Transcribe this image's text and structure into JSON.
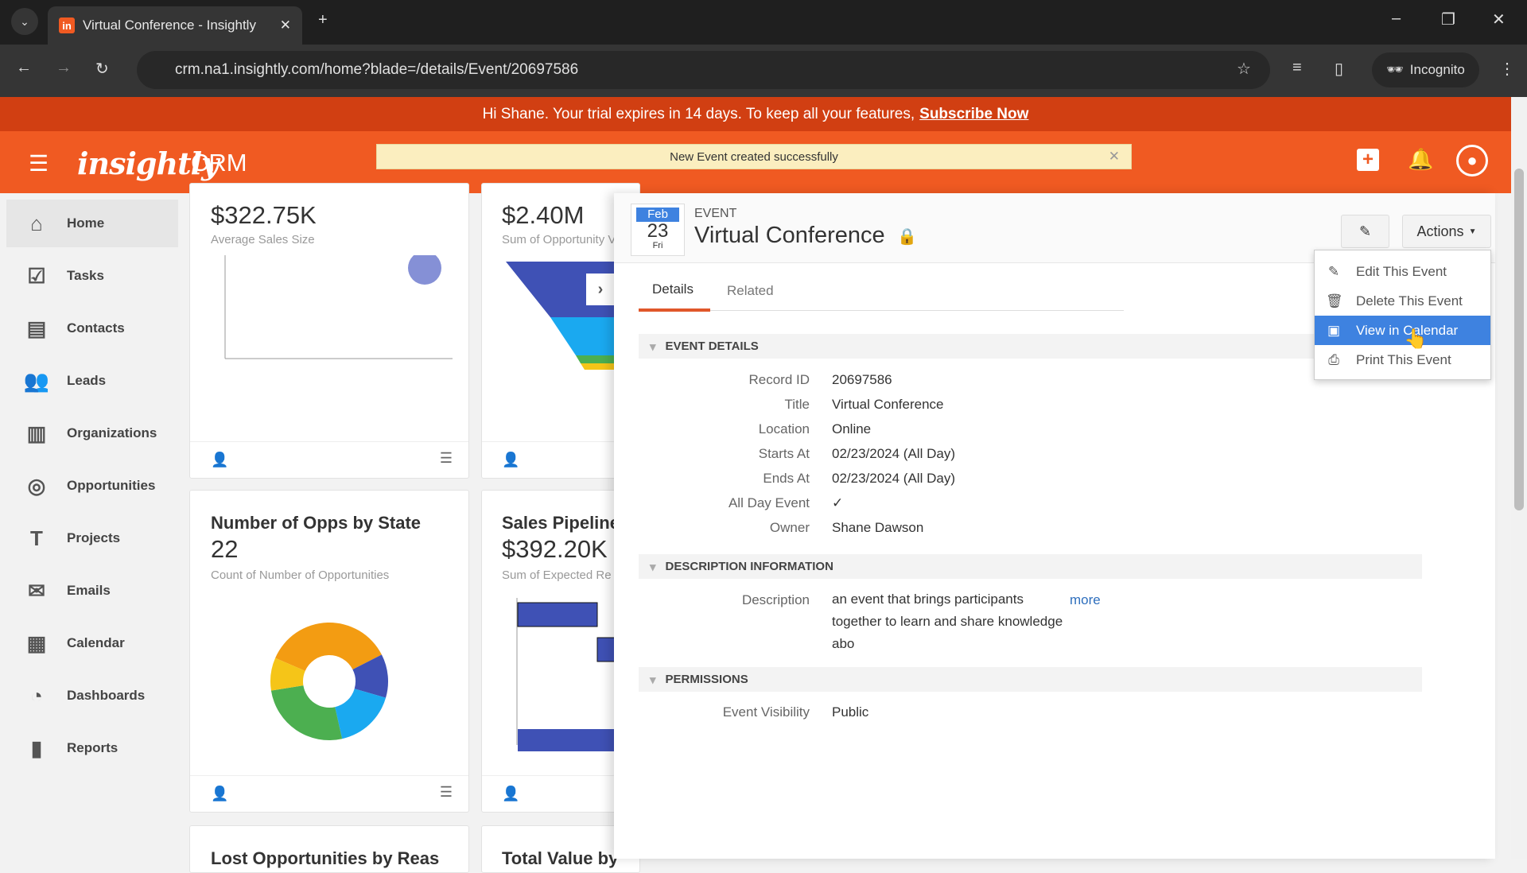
{
  "browser": {
    "tab_title": "Virtual Conference - Insightly",
    "url": "crm.na1.insightly.com/home?blade=/details/Event/20697586",
    "incognito_label": "Incognito"
  },
  "trial": {
    "text": "Hi Shane. Your trial expires in 14 days. To keep all your features,",
    "link": "Subscribe Now"
  },
  "header": {
    "logo": "insightly",
    "product": "CRM",
    "toast": "New Event created successfully"
  },
  "sidebar": {
    "items": [
      {
        "label": "Home",
        "icon": "home-icon"
      },
      {
        "label": "Tasks",
        "icon": "tasks-icon"
      },
      {
        "label": "Contacts",
        "icon": "contacts-icon"
      },
      {
        "label": "Leads",
        "icon": "leads-icon"
      },
      {
        "label": "Organizations",
        "icon": "organizations-icon"
      },
      {
        "label": "Opportunities",
        "icon": "opportunities-icon"
      },
      {
        "label": "Projects",
        "icon": "projects-icon"
      },
      {
        "label": "Emails",
        "icon": "emails-icon"
      },
      {
        "label": "Calendar",
        "icon": "calendar-icon"
      },
      {
        "label": "Dashboards",
        "icon": "dashboards-icon"
      },
      {
        "label": "Reports",
        "icon": "reports-icon"
      }
    ]
  },
  "dashboard": {
    "cards": [
      {
        "value": "$322.75K",
        "subtitle": "Average Sales Size"
      },
      {
        "value": "$2.40M",
        "subtitle": "Sum of Opportunity V"
      },
      {
        "title": "Number of Opps by State",
        "value": "22",
        "subtitle": "Count of Number of Opportunities"
      },
      {
        "title": "Sales Pipeline",
        "value": "$392.20K",
        "subtitle": "Sum of Expected Re"
      },
      {
        "title": "Lost Opportunities by Reas"
      },
      {
        "title": "Total Value by"
      }
    ],
    "donut_colors": [
      "#f39c12",
      "#3f51b5",
      "#1aa9f0",
      "#4caf50",
      "#f5c518"
    ]
  },
  "event": {
    "date_month": "Feb",
    "date_day": "23",
    "date_weekday": "Fri",
    "type_label": "EVENT",
    "title": "Virtual Conference",
    "actions_label": "Actions",
    "tabs": [
      "Details",
      "Related"
    ],
    "sections": {
      "details": "EVENT DETAILS",
      "description": "DESCRIPTION INFORMATION",
      "permissions": "PERMISSIONS"
    },
    "fields": [
      {
        "label": "Record ID",
        "value": "20697586"
      },
      {
        "label": "Title",
        "value": "Virtual Conference"
      },
      {
        "label": "Location",
        "value": "Online"
      },
      {
        "label": "Starts At",
        "value": "02/23/2024 (All Day)"
      },
      {
        "label": "Ends At",
        "value": "02/23/2024 (All Day)"
      },
      {
        "label": "All Day Event",
        "value": "✓"
      },
      {
        "label": "Owner",
        "value": "Shane Dawson"
      }
    ],
    "description": {
      "label": "Description",
      "lines": [
        "an event that brings participants",
        "together to learn and share knowledge",
        "abo"
      ],
      "more": "more"
    },
    "visibility": {
      "label": "Event Visibility",
      "value": "Public"
    }
  },
  "actions_menu": [
    {
      "label": "Edit This Event",
      "icon": "pencil-icon"
    },
    {
      "label": "Delete This Event",
      "icon": "trash-icon"
    },
    {
      "label": "View in Calendar",
      "icon": "calendar-icon",
      "highlighted": true
    },
    {
      "label": "Print This Event",
      "icon": "print-icon"
    }
  ],
  "colors": {
    "brand": "#f05a22",
    "banner": "#d13f12",
    "highlight": "#3e82e0"
  }
}
